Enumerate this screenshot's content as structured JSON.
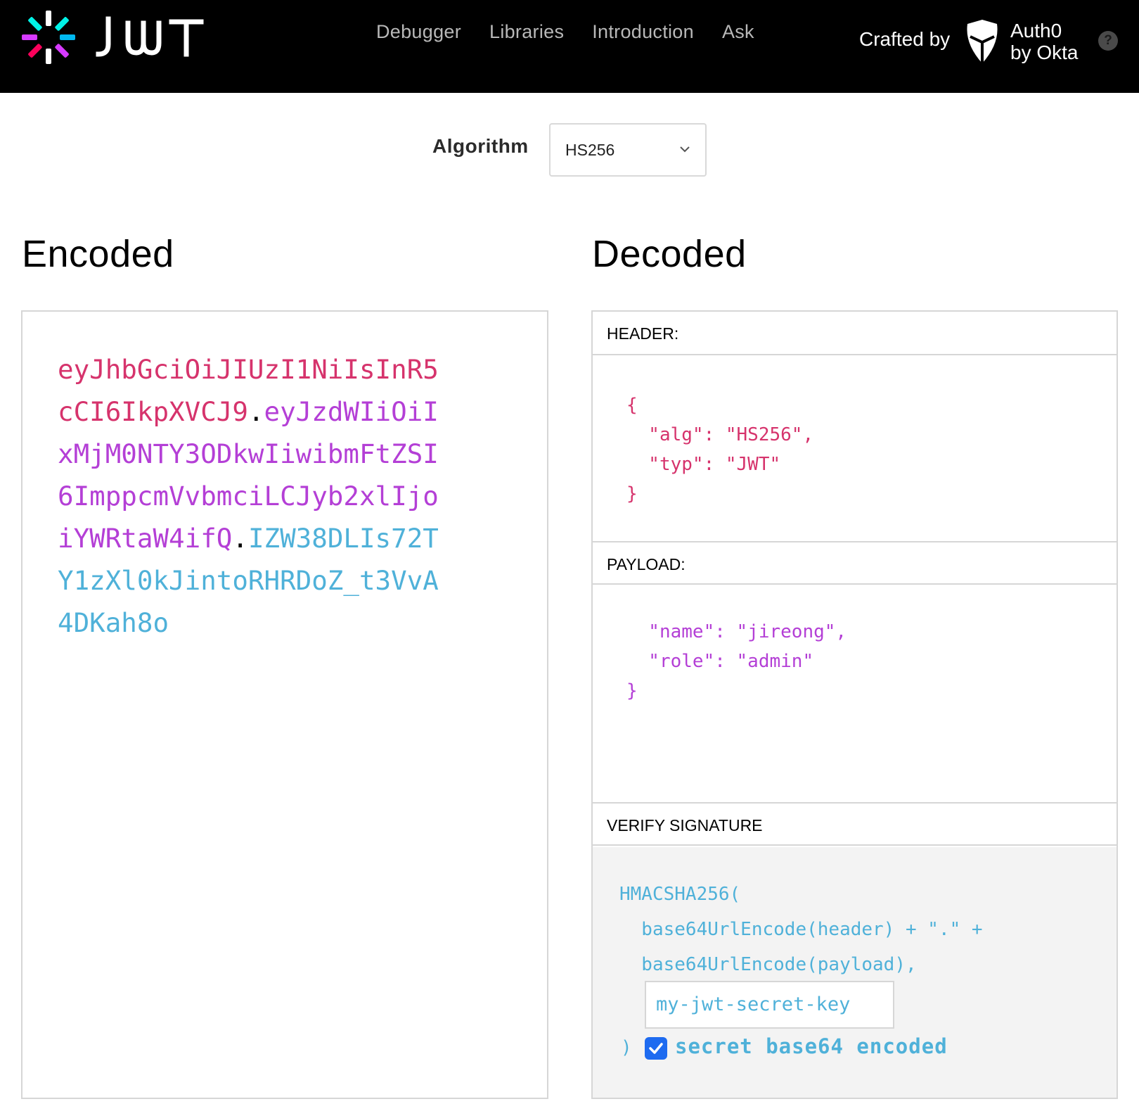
{
  "nav": {
    "items": [
      "Debugger",
      "Libraries",
      "Introduction",
      "Ask"
    ]
  },
  "brand": {
    "logo_text": "JWT",
    "crafted_by": "Crafted by",
    "auth0_line1": "Auth0",
    "auth0_line2": "by Okta",
    "help": "?"
  },
  "algorithm": {
    "label": "Algorithm",
    "value": "HS256"
  },
  "encoded": {
    "title": "Encoded",
    "header_part": "eyJhbGciOiJIUzI1NiIsInR5cCI6IkpXVCJ9",
    "dot1": ".",
    "payload_part": "eyJzdWIiOiIxMjM0NTY3ODkwIiwibmFtZSI6ImppcmVvbmciLCJyb2xlIjoiYWRtaW4ifQ",
    "dot2": ".",
    "signature_part": "IZW38DLIs72TY1zXl0kJintoRHRDoZ_t3VvA4DKah8o"
  },
  "decoded": {
    "title": "Decoded",
    "header_title": "HEADER:",
    "header_lines": [
      "{",
      "  \"alg\": \"HS256\",",
      "  \"typ\": \"JWT\"",
      "}"
    ],
    "payload_title": "PAYLOAD:",
    "payload_lines": [
      "  \"name\": \"jireong\",",
      "  \"role\": \"admin\"",
      "}"
    ],
    "verify_title": "VERIFY SIGNATURE",
    "verify_lines": [
      "HMACSHA256(",
      "  base64UrlEncode(header) + \".\" +",
      "  base64UrlEncode(payload),"
    ],
    "secret_value": "my-jwt-secret-key",
    "close_paren": ")",
    "checkbox_label": "secret base64 encoded",
    "checkbox_checked": true
  },
  "colors": {
    "header_red": "#d6336c",
    "payload_purple": "#b43fd6",
    "signature_blue": "#4fb1d9",
    "checkbox_blue": "#1e6bf0"
  }
}
